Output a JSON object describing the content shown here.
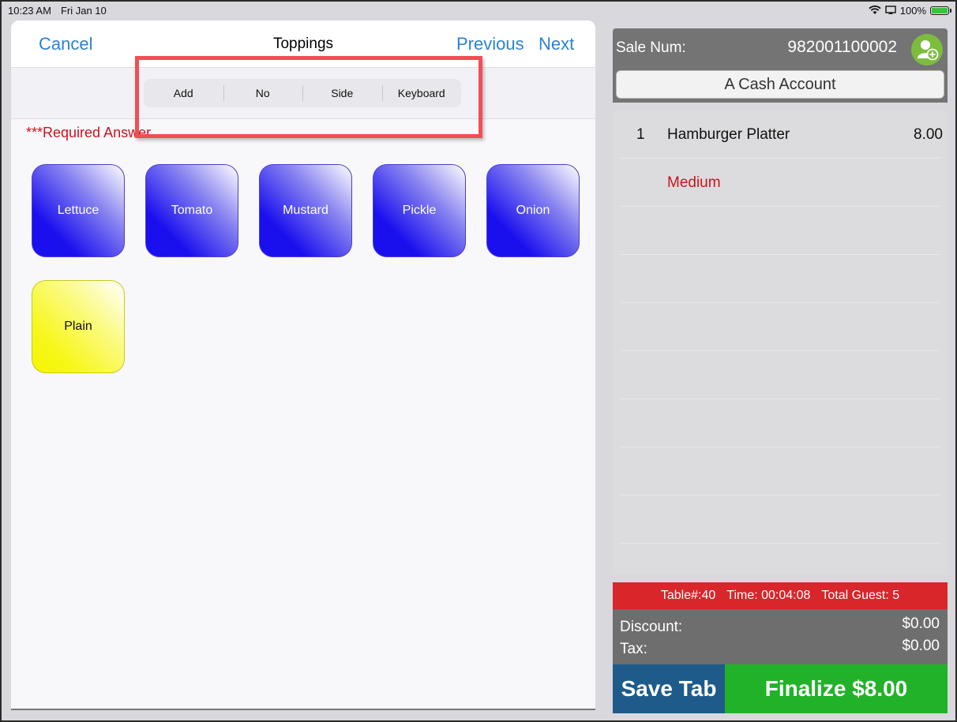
{
  "status_bar": {
    "time": "10:23 AM",
    "date": "Fri Jan 10",
    "battery": "100%",
    "battery_level": 1.0
  },
  "modal": {
    "cancel_label": "Cancel",
    "title": "Toppings",
    "previous_label": "Previous",
    "next_label": "Next",
    "modes": [
      {
        "label": "Add"
      },
      {
        "label": "No"
      },
      {
        "label": "Side"
      },
      {
        "label": "Keyboard"
      }
    ],
    "required_text": "***Required Answer",
    "options": [
      {
        "label": "Lettuce",
        "color": "#1a10ee"
      },
      {
        "label": "Tomato",
        "color": "#1a10ee"
      },
      {
        "label": "Mustard",
        "color": "#1a10ee"
      },
      {
        "label": "Pickle",
        "color": "#1a10ee"
      },
      {
        "label": "Onion",
        "color": "#1a10ee"
      },
      {
        "label": "Plain",
        "color": "#f7f71a"
      }
    ]
  },
  "sale": {
    "label": "Sale Num:",
    "number": "982001100002",
    "account": "A Cash Account",
    "items": [
      {
        "qty": "1",
        "name": "Hamburger Platter",
        "price": "8.00"
      }
    ],
    "modifiers": [
      {
        "name": "Medium"
      }
    ]
  },
  "table_info": {
    "table": "Table#:40",
    "time": "Time: 00:04:08",
    "guests": "Total Guest: 5"
  },
  "totals": {
    "discount_label": "Discount:",
    "discount_value": "$0.00",
    "tax_label": "Tax:",
    "tax_value": "$0.00"
  },
  "actions": {
    "save_tab_label": "Save Tab",
    "finalize_label": "Finalize $8.00"
  },
  "colors": {
    "accent_blue": "#2b82d1",
    "required_red": "#c8141f",
    "table_bar_red": "#d9262b",
    "save_tab_blue": "#1f5b8a",
    "finalize_green": "#22b22a",
    "highlight_box": "#f04f55"
  }
}
